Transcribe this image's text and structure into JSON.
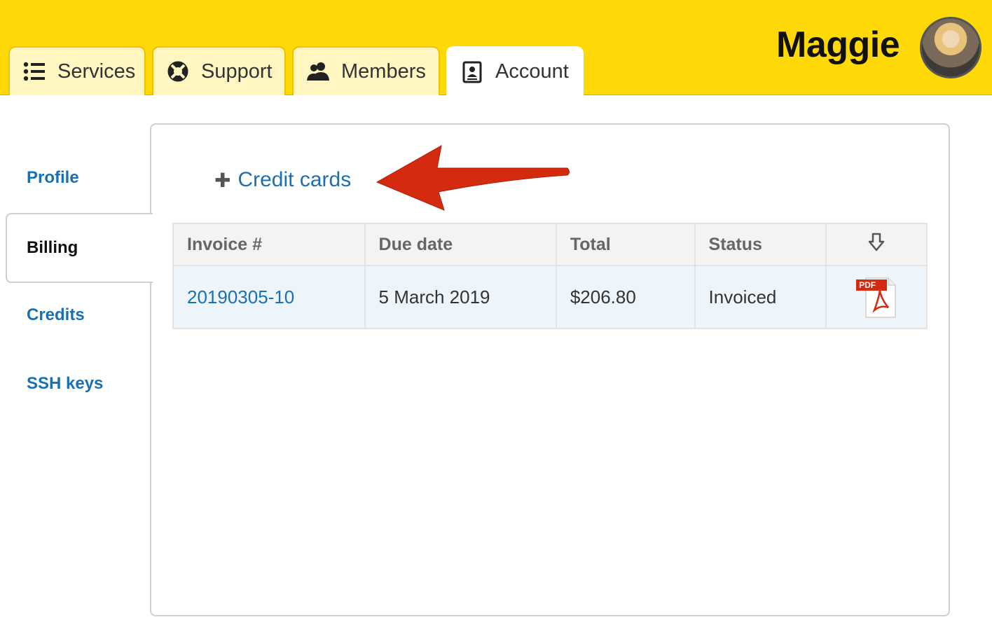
{
  "header": {
    "tabs": [
      {
        "label": "Services",
        "icon": "list-icon"
      },
      {
        "label": "Support",
        "icon": "lifebuoy-icon"
      },
      {
        "label": "Members",
        "icon": "users-icon"
      },
      {
        "label": "Account",
        "icon": "id-card-icon",
        "active": true
      }
    ],
    "username": "Maggie",
    "avatar_icon": "avatar-icon"
  },
  "sidebar": {
    "items": [
      {
        "label": "Profile"
      },
      {
        "label": "Billing",
        "active": true
      },
      {
        "label": "Credits"
      },
      {
        "label": "SSH keys"
      }
    ]
  },
  "main": {
    "credit_cards_label": "Credit cards",
    "annotation_arrow_color": "#d42a10",
    "table": {
      "headers": [
        "Invoice #",
        "Due date",
        "Total",
        "Status"
      ],
      "download_icon": "download-arrow-icon",
      "rows": [
        {
          "invoice": "20190305-10",
          "due_date": "5 March 2019",
          "total": "$206.80",
          "status": "Invoiced",
          "pdf_label": "PDF",
          "file_icon": "pdf-icon"
        }
      ]
    }
  },
  "colors": {
    "topbar": "#ffd807",
    "link": "#1a70b0",
    "tab_inactive": "#fff6c2",
    "row_bg": "#edf5fb"
  }
}
